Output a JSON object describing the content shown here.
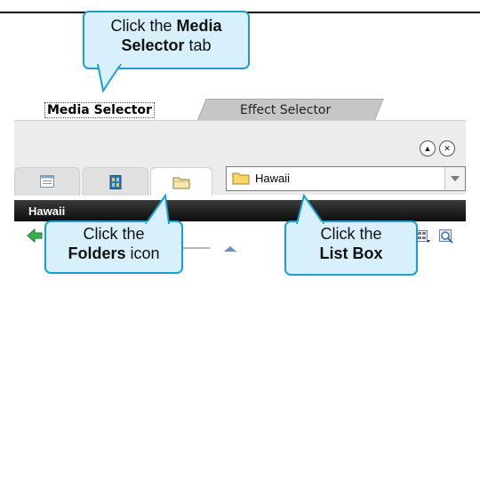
{
  "tabs": {
    "media": "Media Selector",
    "effect": "Effect Selector"
  },
  "combo": {
    "value": "Hawaii"
  },
  "panel_title": "Hawaii",
  "callouts": {
    "media": {
      "line1": "Click the ",
      "bold1": "Media",
      "bold2": "Selector",
      "line2": " tab"
    },
    "folders": {
      "line1": "Click the",
      "bold": "Folders",
      "rest": " icon"
    },
    "listbox": {
      "line1": "Click the",
      "bold": "List Box"
    }
  },
  "icons": {
    "tab_icons": [
      "list-view-icon",
      "film-icon",
      "folder-icon"
    ],
    "combo_icon": "folder-icon",
    "back": "back-arrow-icon",
    "view": "view-options-icon",
    "zoom": "zoom-icon",
    "scroll_up": "scroll-up-icon",
    "collapse": "collapse-icon",
    "close": "close-icon"
  },
  "colors": {
    "callout_fill": "#d8f0fb",
    "callout_border": "#1d9fcb",
    "title_bar": "#1a1a1a"
  }
}
